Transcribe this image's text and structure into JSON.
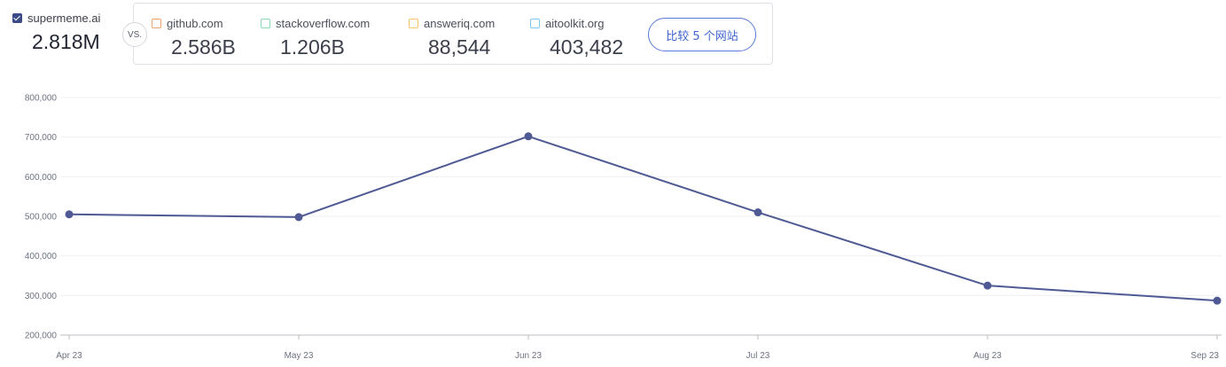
{
  "primary_site": {
    "name": "supermeme.ai",
    "value": "2.818M",
    "checked": true,
    "color": "#3c4a86"
  },
  "vs_label": "VS.",
  "compare_sites": [
    {
      "name": "github.com",
      "value": "2.586B",
      "color": "#f0a36b"
    },
    {
      "name": "stackoverflow.com",
      "value": "1.206B",
      "color": "#8ed6b0"
    },
    {
      "name": "answeriq.com",
      "value": "88,544",
      "color": "#f3c965"
    },
    {
      "name": "aitoolkit.org",
      "value": "403,482",
      "color": "#7fc6ec"
    }
  ],
  "compare_button": {
    "label": "比较 5 个网站"
  },
  "chart_data": {
    "type": "line",
    "categories": [
      "Apr 23",
      "May 23",
      "Jun 23",
      "Jul 23",
      "Aug 23",
      "Sep 23"
    ],
    "series": [
      {
        "values": [
          505000,
          498000,
          702000,
          510000,
          325000,
          287000
        ],
        "color": "#4f5a94"
      }
    ],
    "ylim": [
      200000,
      800000
    ],
    "yticks": [
      200000,
      300000,
      400000,
      500000,
      600000,
      700000,
      800000
    ],
    "ytick_labels": [
      "200,000",
      "300,000",
      "400,000",
      "500,000",
      "600,000",
      "700,000",
      "800,000"
    ],
    "grid": true,
    "title": "",
    "xlabel": "",
    "ylabel": ""
  }
}
